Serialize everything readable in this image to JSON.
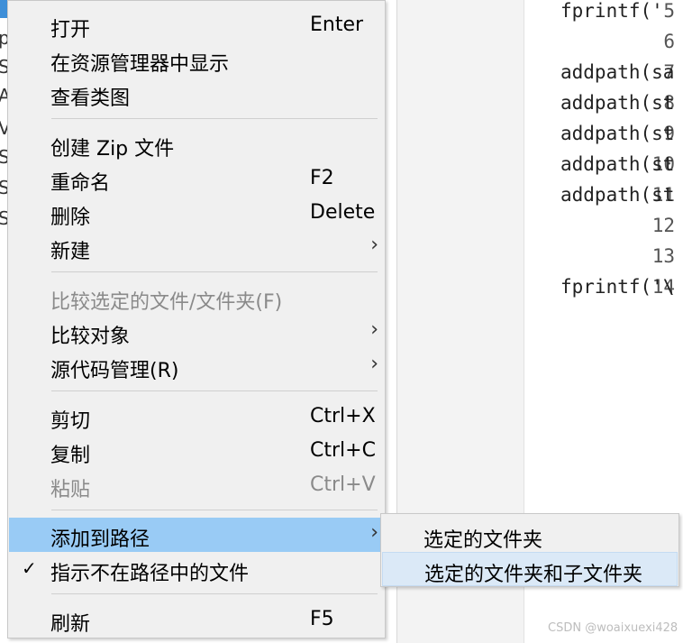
{
  "file_browser": {
    "fragments": [
      "p",
      "S",
      "A",
      "V",
      "S",
      "S",
      "S"
    ]
  },
  "editor": {
    "lines": [
      {
        "no": "5",
        "code": "fprintf('"
      },
      {
        "no": "6",
        "code": ""
      },
      {
        "no": "7",
        "code": "addpath(sa"
      },
      {
        "no": "8",
        "code": "addpath(st"
      },
      {
        "no": "9",
        "code": "addpath(st"
      },
      {
        "no": "10",
        "code": "addpath(st"
      },
      {
        "no": "11",
        "code": "addpath(st"
      },
      {
        "no": "12",
        "code": ""
      },
      {
        "no": "13",
        "code": ""
      },
      {
        "no": "14",
        "code": "fprintf('\\"
      }
    ]
  },
  "context_menu": {
    "items": [
      {
        "label": "打开",
        "shortcut": "Enter"
      },
      {
        "label": "在资源管理器中显示",
        "shortcut": ""
      },
      {
        "label": "查看类图",
        "shortcut": ""
      },
      {
        "label": "创建 Zip 文件",
        "shortcut": ""
      },
      {
        "label": "重命名",
        "shortcut": "F2"
      },
      {
        "label": "删除",
        "shortcut": "Delete"
      },
      {
        "label": "新建",
        "shortcut": ""
      },
      {
        "label": "比较选定的文件/文件夹(F)",
        "shortcut": ""
      },
      {
        "label": "比较对象",
        "shortcut": ""
      },
      {
        "label": "源代码管理(R)",
        "shortcut": ""
      },
      {
        "label": "剪切",
        "shortcut": "Ctrl+X"
      },
      {
        "label": "复制",
        "shortcut": "Ctrl+C"
      },
      {
        "label": "粘贴",
        "shortcut": "Ctrl+V"
      },
      {
        "label": "添加到路径",
        "shortcut": ""
      },
      {
        "label": "指示不在路径中的文件",
        "shortcut": ""
      },
      {
        "label": "刷新",
        "shortcut": "F5"
      }
    ],
    "submenu_arrow": "›",
    "check_mark": "✓"
  },
  "submenu": {
    "items": [
      {
        "label": "选定的文件夹"
      },
      {
        "label": "选定的文件夹和子文件夹"
      }
    ]
  },
  "watermark": "CSDN @woaixuexi428"
}
